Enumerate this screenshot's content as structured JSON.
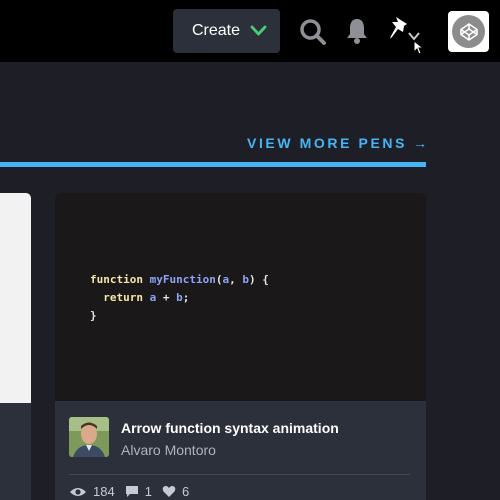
{
  "header": {
    "create_label": "Create",
    "icons": [
      "chevron-down-icon",
      "search-icon",
      "bell-icon",
      "pin-icon",
      "cursor-icon",
      "codepen-logo-icon"
    ],
    "accent_green": "#47cf73"
  },
  "section": {
    "view_more_label": "VIEW MORE PENS",
    "view_more_arrow": "→",
    "accent_blue": "#47b4f5"
  },
  "pen": {
    "code_lines": [
      [
        "function",
        "myFunction",
        "(",
        "a",
        ", ",
        "b",
        ") {"
      ],
      [
        "return",
        "a",
        " + ",
        "b",
        ";"
      ],
      [
        "}"
      ]
    ],
    "title": "Arrow function syntax animation",
    "author": "Alvaro Montoro",
    "stats": {
      "views": "184",
      "comments": "1",
      "likes": "6"
    }
  }
}
